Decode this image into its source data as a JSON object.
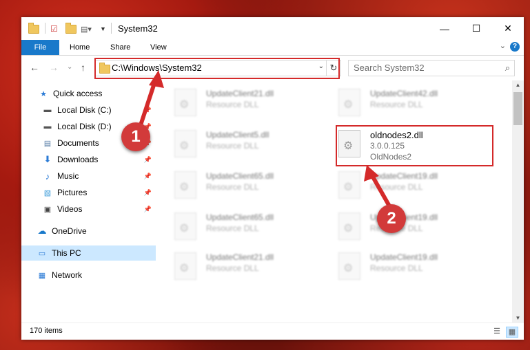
{
  "window": {
    "title": "System32",
    "controls": {
      "minimize": "—",
      "maximize": "☐",
      "close": "✕"
    }
  },
  "ribbon": {
    "tabs": [
      "File",
      "Home",
      "Share",
      "View"
    ],
    "help": "?"
  },
  "nav": {
    "back": "←",
    "forward": "→",
    "recent": "⌄",
    "up": "↑",
    "address": "C:\\Windows\\System32",
    "search_placeholder": "Search System32"
  },
  "sidebar": {
    "items": [
      {
        "label": "Quick access",
        "icon": "star-icon",
        "pinned": false
      },
      {
        "label": "Local Disk (C:)",
        "icon": "drive-icon",
        "pinned": true
      },
      {
        "label": "Local Disk (D:)",
        "icon": "drive-icon",
        "pinned": true
      },
      {
        "label": "Documents",
        "icon": "document-icon",
        "pinned": true
      },
      {
        "label": "Downloads",
        "icon": "download-icon",
        "pinned": true
      },
      {
        "label": "Music",
        "icon": "music-icon",
        "pinned": true
      },
      {
        "label": "Pictures",
        "icon": "pictures-icon",
        "pinned": true
      },
      {
        "label": "Videos",
        "icon": "video-icon",
        "pinned": true
      },
      {
        "label": "OneDrive",
        "icon": "cloud-icon",
        "pinned": false
      },
      {
        "label": "This PC",
        "icon": "computer-icon",
        "pinned": false,
        "selected": true
      },
      {
        "label": "Network",
        "icon": "network-icon",
        "pinned": false
      }
    ]
  },
  "files": [
    {
      "name": "UpdateClient21.dll",
      "type": "Resource DLL",
      "blurred": true
    },
    {
      "name": "UpdateClient42.dll",
      "type": "Resource DLL",
      "blurred": true
    },
    {
      "name": "UpdateClient5.dll",
      "type": "Resource DLL",
      "blurred": true
    },
    {
      "name": "oldnodes2.dll",
      "version": "3.0.0.125",
      "type": "OldNodes2",
      "blurred": false
    },
    {
      "name": "UpdateClient65.dll",
      "type": "Resource DLL",
      "blurred": true
    },
    {
      "name": "UpdateClient19.dll",
      "type": "Resource DLL",
      "blurred": true
    },
    {
      "name": "UpdateClient65.dll",
      "type": "Resource DLL",
      "blurred": true
    },
    {
      "name": "UpdateClient19.dll",
      "type": "Resource DLL",
      "blurred": true
    },
    {
      "name": "UpdateClient21.dll",
      "type": "Resource DLL",
      "blurred": true
    },
    {
      "name": "UpdateClient19.dll",
      "type": "Resource DLL",
      "blurred": true
    }
  ],
  "status": {
    "count": "170 items"
  },
  "annotations": {
    "badge1": "1",
    "badge2": "2"
  },
  "colors": {
    "accent": "#1979ca",
    "highlight": "#d42a2a",
    "selected": "#cce8ff"
  }
}
